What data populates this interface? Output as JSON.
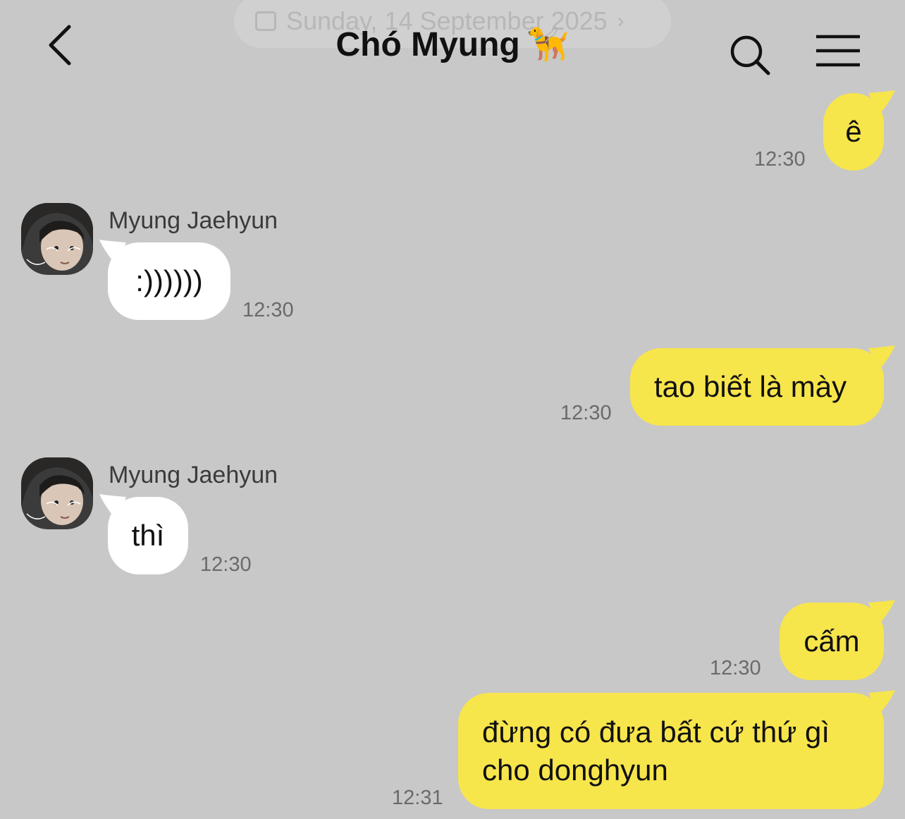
{
  "header": {
    "date_label": "Sunday, 14 September 2025",
    "title": "Chó Myung",
    "title_emoji": "🦮"
  },
  "messages": [
    {
      "from": "me",
      "text": "ê",
      "time": "12:30"
    },
    {
      "from": "them",
      "sender": "Myung Jaehyun",
      "text": ":))))))",
      "time": "12:30"
    },
    {
      "from": "me",
      "text": "tao biết là mày",
      "time": "12:30"
    },
    {
      "from": "them",
      "sender": "Myung Jaehyun",
      "text": "thì",
      "time": "12:30"
    },
    {
      "from": "me",
      "text": "cấm",
      "time": "12:30"
    },
    {
      "from": "me",
      "text_line1": "đừng có đưa bất cứ thứ gì",
      "text_line2": "cho donghyun",
      "time": "12:31"
    }
  ],
  "colors": {
    "background": "#c8c8c8",
    "my_bubble": "#f7e54c",
    "their_bubble": "#ffffff"
  },
  "icons": {
    "back": "chevron-left-icon",
    "search": "search-icon",
    "menu": "hamburger-menu-icon",
    "date": "calendar-icon"
  }
}
